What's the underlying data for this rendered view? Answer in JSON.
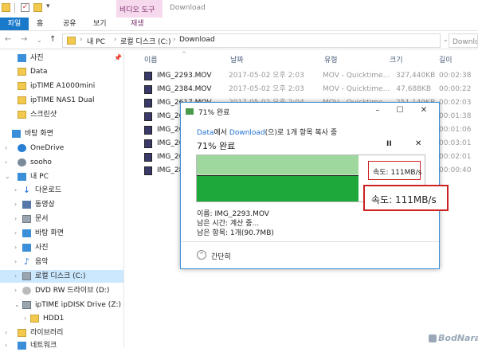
{
  "titlebar": {
    "video_tools": "비디오 도구",
    "window_title": "Download"
  },
  "ribbon": {
    "tabs": [
      {
        "label": "파일"
      },
      {
        "label": "홈"
      },
      {
        "label": "공유"
      },
      {
        "label": "보기"
      },
      {
        "label": "재생"
      }
    ]
  },
  "address": {
    "crumbs": [
      "내 PC",
      "로컬 디스크 (C:)",
      "Download"
    ],
    "search_placeholder": "Download 검색"
  },
  "sidebar": {
    "items": [
      {
        "label": "사진",
        "icon": "pictures-folder-icon",
        "pinned": true
      },
      {
        "label": "Data",
        "icon": "folder-icon"
      },
      {
        "label": "ipTIME A1000mini",
        "icon": "folder-icon"
      },
      {
        "label": "ipTIME NAS1 Dual",
        "icon": "folder-icon"
      },
      {
        "label": "스크린샷",
        "icon": "folder-icon"
      },
      {
        "label": "바탕 화면",
        "icon": "desktop-icon"
      },
      {
        "label": "OneDrive",
        "icon": "cloud-icon"
      },
      {
        "label": "sooho",
        "icon": "user-icon"
      },
      {
        "label": "내 PC",
        "icon": "pc-icon"
      },
      {
        "label": "다운로드",
        "icon": "download-icon"
      },
      {
        "label": "동영상",
        "icon": "videos-icon"
      },
      {
        "label": "문서",
        "icon": "documents-icon"
      },
      {
        "label": "바탕 화면",
        "icon": "desktop-icon"
      },
      {
        "label": "사진",
        "icon": "pictures-icon"
      },
      {
        "label": "음악",
        "icon": "music-icon"
      },
      {
        "label": "로컬 디스크 (C:)",
        "icon": "drive-icon",
        "selected": true
      },
      {
        "label": "DVD RW 드라이브 (D:)",
        "icon": "dvd-icon"
      },
      {
        "label": "ipTIME ipDISK Drive (Z:)",
        "icon": "network-drive-icon"
      },
      {
        "label": "HDD1",
        "icon": "folder-icon"
      },
      {
        "label": "라이브러리",
        "icon": "library-icon"
      },
      {
        "label": "네트워크",
        "icon": "network-icon"
      }
    ]
  },
  "file_list": {
    "columns": [
      "이름",
      "날짜",
      "유형",
      "크기",
      "길이"
    ],
    "rows": [
      {
        "name": "IMG_2293.MOV",
        "date": "2017-05-02 오후 2:03",
        "type": "MOV - Quicktime...",
        "size": "327,440KB",
        "length": "00:02:38"
      },
      {
        "name": "IMG_2384.MOV",
        "date": "2017-05-02 오후 2:03",
        "type": "MOV - Quicktime...",
        "size": "47,688KB",
        "length": "00:00:22"
      },
      {
        "name": "IMG_2617.MOV",
        "date": "2017-05-02 오후 2:04",
        "type": "MOV - Quicktime...",
        "size": "251,149KB",
        "length": "00:02:03"
      },
      {
        "name": "IMG_26",
        "date": "",
        "type": "",
        "size": "",
        "length": "00:01:38"
      },
      {
        "name": "IMG_26",
        "date": "",
        "type": "",
        "size": "",
        "length": "00:01:06"
      },
      {
        "name": "IMG_26",
        "date": "",
        "type": "",
        "size": "",
        "length": "00:03:01"
      },
      {
        "name": "IMG_26",
        "date": "",
        "type": "",
        "size": "",
        "length": "00:02:01"
      },
      {
        "name": "IMG_28",
        "date": "",
        "type": "",
        "size": "",
        "length": "00:00:40"
      }
    ]
  },
  "dialog": {
    "title": "71% 완료",
    "msg_src": "Data",
    "msg_mid": "에서 ",
    "msg_dst": "Download",
    "msg_tail": "(으)로 1개 항목 복사 중",
    "heading": "71% 완료",
    "pause": "II",
    "cancel": "✕",
    "progress_percent": 71,
    "speed_small": "속도: 111MB/s",
    "info_name": "이름: IMG_2293.MOV",
    "info_remaining_time": "남은 시간: 계산 중...",
    "info_remaining_items": "남은 항목: 1개(90.7MB)",
    "collapse_label": "간단히"
  },
  "callout": {
    "speed": "속도: 111MB/s"
  },
  "watermark": "BodNara"
}
